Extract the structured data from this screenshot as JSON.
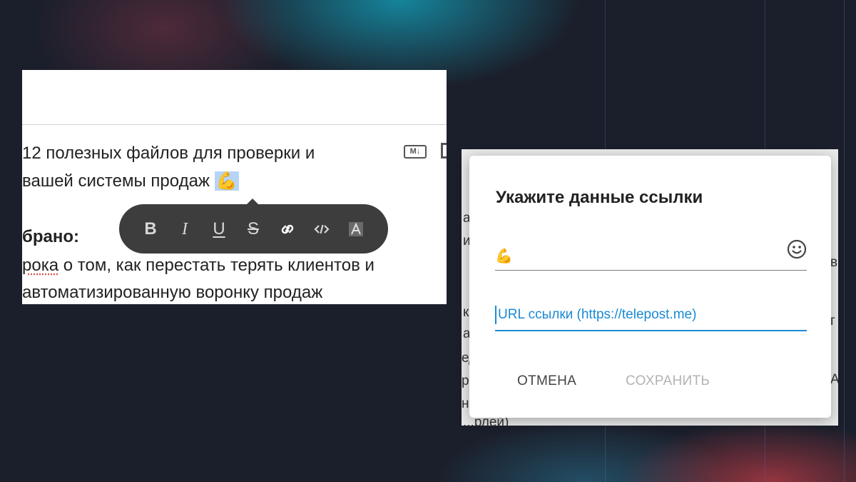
{
  "editor": {
    "line1": "12 полезных файлов для проверки и",
    "line2": "вашей системы продаж",
    "line2_emoji": "💪",
    "line3": "брано:",
    "line4_word": "рока",
    "line4_rest": " о том, как перестать терять клиентов и",
    "line5": "автоматизированную воронку продаж",
    "md_icon_label": "M↓",
    "markdown_icon": "markdown-icon",
    "fullscreen_icon": "fullscreen-icon"
  },
  "toolbar": {
    "bold": "B",
    "italic": "I",
    "underline": "U",
    "strikethrough": "S",
    "icons": [
      "bold-icon",
      "italic-icon",
      "underline-icon",
      "strikethrough-icon",
      "link-icon",
      "code-icon",
      "spoiler-icon"
    ]
  },
  "backdrop": {
    "fragments": [
      "а",
      "и",
      "к",
      "а",
      "ед",
      "р",
      "но",
      "в",
      "г",
      "А",
      "...рлей)"
    ]
  },
  "dialog": {
    "title": "Укажите данные ссылки",
    "text_value": "💪",
    "emoji_button_icon": "smile-icon",
    "url_placeholder": "URL ссылки (https://telepost.me)",
    "cancel_label": "ОТМЕНА",
    "save_label": "СОХРАНИТЬ"
  },
  "colors": {
    "accent": "#1a8ad4",
    "toolbar_bg": "#3d3d3d",
    "selection": "#b7d4f5"
  }
}
